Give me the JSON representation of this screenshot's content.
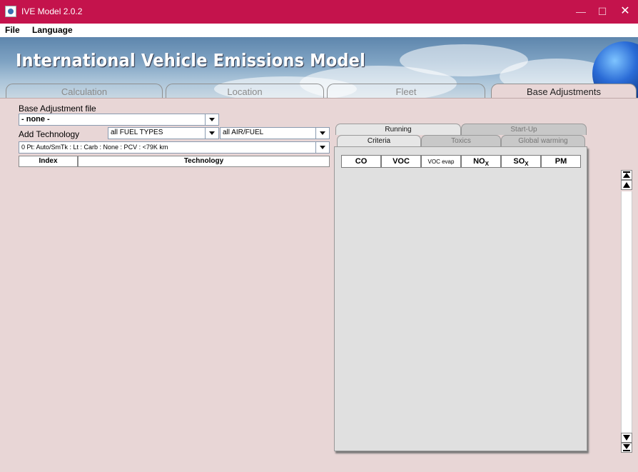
{
  "window": {
    "title": "IVE Model 2.0.2",
    "minimize_label": "—",
    "maximize_label": "☐",
    "close_label": "✕"
  },
  "menu": {
    "file": "File",
    "language": "Language"
  },
  "banner": {
    "title": "International Vehicle Emissions Model"
  },
  "main_tabs": [
    {
      "label": "Calculation",
      "active": false
    },
    {
      "label": "Location",
      "active": false
    },
    {
      "label": "Fleet",
      "active": false
    },
    {
      "label": "Base Adjustments",
      "active": true
    }
  ],
  "base_adjustment": {
    "file_label": "Base Adjustment file",
    "file_value": "- none -",
    "add_technology_label": "Add Technology",
    "fuel_type_value": "all FUEL TYPES",
    "air_fuel_value": "all AIR/FUEL",
    "technology_value": "0   Pt: Auto/SmTk : Lt : Carb : None : PCV : <79K km",
    "table_headers": {
      "index": "Index",
      "technology": "Technology"
    }
  },
  "right_panel": {
    "top_tabs": [
      {
        "label": "Running",
        "active": true
      },
      {
        "label": "Start-Up",
        "active": false
      }
    ],
    "sub_tabs": [
      {
        "label": "Criteria",
        "active": true
      },
      {
        "label": "Toxics",
        "active": false
      },
      {
        "label": "Global warming",
        "active": false
      }
    ],
    "columns": [
      "CO",
      "VOC",
      "VOC evap",
      "NOx",
      "SOx",
      "PM"
    ]
  },
  "colors": {
    "title_bar": "#c4134c",
    "background": "#e8d6d6",
    "panel": "#e0e0e0"
  }
}
